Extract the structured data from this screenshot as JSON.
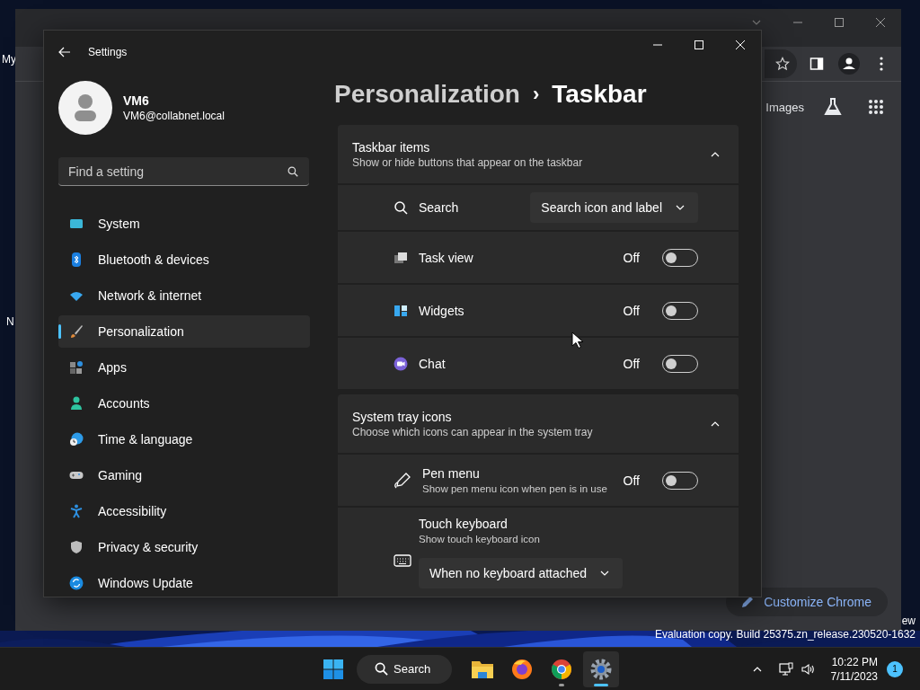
{
  "desktop": {
    "icon_labels": [
      "My",
      "N"
    ],
    "watermark": [
      "ew",
      "Evaluation copy. Build 25375.zn_release.230520-1632"
    ]
  },
  "browser": {
    "link": "Images",
    "customize_button": "Customize Chrome"
  },
  "settings": {
    "title": "Settings",
    "user": {
      "name": "VM6",
      "email": "VM6@collabnet.local"
    },
    "search": {
      "placeholder": "Find a setting"
    },
    "nav": [
      {
        "label": "System",
        "selected": false
      },
      {
        "label": "Bluetooth & devices",
        "selected": false
      },
      {
        "label": "Network & internet",
        "selected": false
      },
      {
        "label": "Personalization",
        "selected": true
      },
      {
        "label": "Apps",
        "selected": false
      },
      {
        "label": "Accounts",
        "selected": false
      },
      {
        "label": "Time & language",
        "selected": false
      },
      {
        "label": "Gaming",
        "selected": false
      },
      {
        "label": "Accessibility",
        "selected": false
      },
      {
        "label": "Privacy & security",
        "selected": false
      },
      {
        "label": "Windows Update",
        "selected": false
      }
    ],
    "breadcrumb": {
      "parent": "Personalization",
      "separator": "›",
      "current": "Taskbar"
    },
    "sections": [
      {
        "title": "Taskbar items",
        "subtitle": "Show or hide buttons that appear on the taskbar",
        "expanded": true,
        "rows": [
          {
            "kind": "dropdown",
            "label": "Search",
            "value": "Search icon and label"
          },
          {
            "kind": "toggle",
            "label": "Task view",
            "state_text": "Off",
            "on": false
          },
          {
            "kind": "toggle",
            "label": "Widgets",
            "state_text": "Off",
            "on": false
          },
          {
            "kind": "toggle",
            "label": "Chat",
            "state_text": "Off",
            "on": false
          }
        ]
      },
      {
        "title": "System tray icons",
        "subtitle": "Choose which icons can appear in the system tray",
        "expanded": true,
        "rows": [
          {
            "kind": "toggle",
            "label": "Pen menu",
            "description": "Show pen menu icon when pen is in use",
            "state_text": "Off",
            "on": false
          },
          {
            "kind": "dropdown_below",
            "label": "Touch keyboard",
            "description": "Show touch keyboard icon",
            "value": "When no keyboard attached"
          }
        ]
      }
    ]
  },
  "taskbar": {
    "search": "Search",
    "apps": [
      {
        "selected": false,
        "running": false
      },
      {
        "selected": false,
        "running": false
      },
      {
        "selected": false,
        "running": true
      },
      {
        "selected": true,
        "running": true
      }
    ],
    "time": "10:22 PM",
    "date": "7/11/2023",
    "notifications": "1"
  }
}
